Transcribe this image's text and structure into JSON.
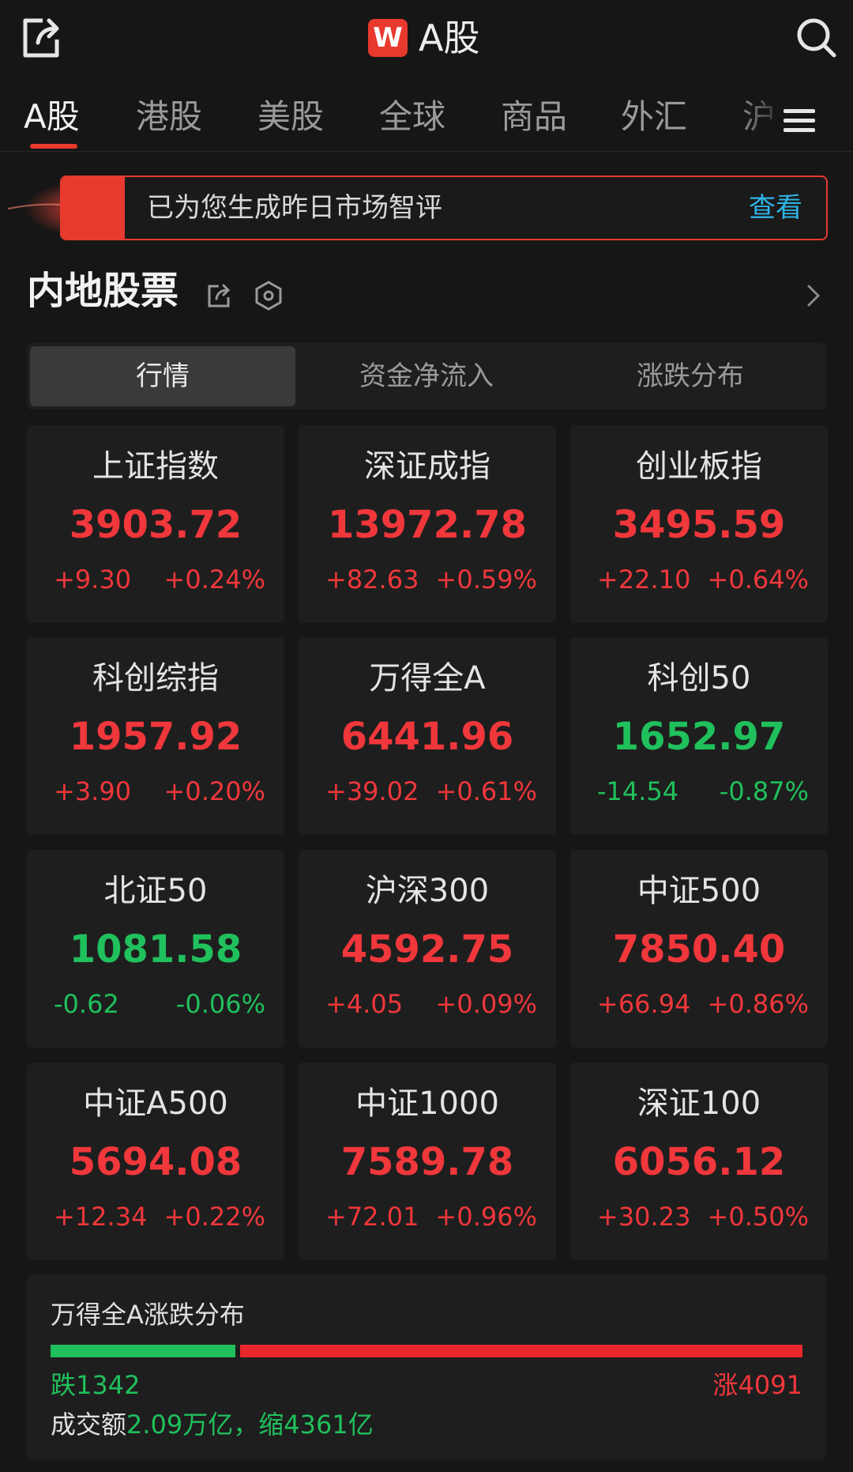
{
  "header": {
    "logo_letter": "W",
    "title": "A股"
  },
  "tabs": [
    "A股",
    "港股",
    "美股",
    "全球",
    "商品",
    "外汇",
    "沪"
  ],
  "banner": {
    "text": "已为您生成昨日市场智评",
    "link": "查看"
  },
  "section": {
    "title": "内地股票"
  },
  "segments": [
    "行情",
    "资金净流入",
    "涨跌分布"
  ],
  "colors": {
    "up": "#f0373b",
    "down": "#20c05c",
    "accent": "#e8392e",
    "link": "#2fb4e6"
  },
  "indices": [
    {
      "name": "上证指数",
      "price": "3903.72",
      "change": "+9.30",
      "pct": "+0.24%",
      "dir": "up"
    },
    {
      "name": "深证成指",
      "price": "13972.78",
      "change": "+82.63",
      "pct": "+0.59%",
      "dir": "up"
    },
    {
      "name": "创业板指",
      "price": "3495.59",
      "change": "+22.10",
      "pct": "+0.64%",
      "dir": "up"
    },
    {
      "name": "科创综指",
      "price": "1957.92",
      "change": "+3.90",
      "pct": "+0.20%",
      "dir": "up"
    },
    {
      "name": "万得全A",
      "price": "6441.96",
      "change": "+39.02",
      "pct": "+0.61%",
      "dir": "up"
    },
    {
      "name": "科创50",
      "price": "1652.97",
      "change": "-14.54",
      "pct": "-0.87%",
      "dir": "down"
    },
    {
      "name": "北证50",
      "price": "1081.58",
      "change": "-0.62",
      "pct": "-0.06%",
      "dir": "down"
    },
    {
      "name": "沪深300",
      "price": "4592.75",
      "change": "+4.05",
      "pct": "+0.09%",
      "dir": "up"
    },
    {
      "name": "中证500",
      "price": "7850.40",
      "change": "+66.94",
      "pct": "+0.86%",
      "dir": "up"
    },
    {
      "name": "中证A500",
      "price": "5694.08",
      "change": "+12.34",
      "pct": "+0.22%",
      "dir": "up"
    },
    {
      "name": "中证1000",
      "price": "7589.78",
      "change": "+72.01",
      "pct": "+0.96%",
      "dir": "up"
    },
    {
      "name": "深证100",
      "price": "6056.12",
      "change": "+30.23",
      "pct": "+0.50%",
      "dir": "up"
    }
  ],
  "distribution": {
    "title": "万得全A涨跌分布",
    "down_label": "跌1342",
    "up_label": "涨4091",
    "down_count": 1342,
    "up_count": 4091,
    "volume_prefix": "成交额",
    "volume_value": "2.09万亿，缩4361亿"
  }
}
